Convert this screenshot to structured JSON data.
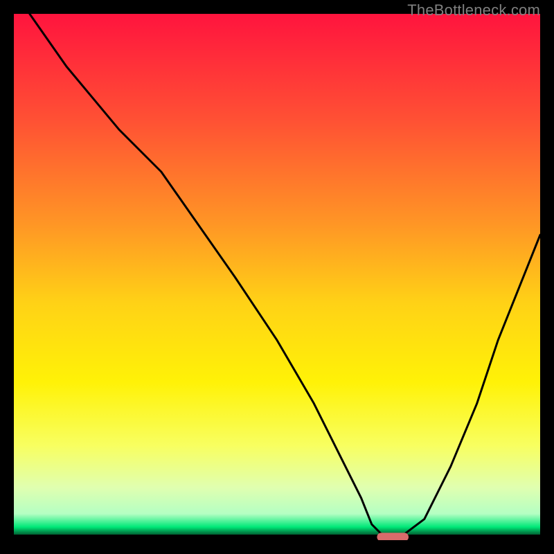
{
  "watermark": {
    "text": "TheBottleneck.com"
  },
  "chart_data": {
    "type": "line",
    "title": "",
    "xlabel": "",
    "ylabel": "",
    "xlim": [
      0,
      100
    ],
    "ylim": [
      0,
      100
    ],
    "grid": false,
    "legend": false,
    "background_gradient": {
      "stops": [
        {
          "pos": 0.0,
          "color": "#ff143e"
        },
        {
          "pos": 0.2,
          "color": "#ff5034"
        },
        {
          "pos": 0.4,
          "color": "#ff9625"
        },
        {
          "pos": 0.55,
          "color": "#ffd216"
        },
        {
          "pos": 0.7,
          "color": "#fff207"
        },
        {
          "pos": 0.82,
          "color": "#f8ff60"
        },
        {
          "pos": 0.9,
          "color": "#e0ffb0"
        },
        {
          "pos": 0.95,
          "color": "#b4ffc3"
        },
        {
          "pos": 0.975,
          "color": "#00e878"
        },
        {
          "pos": 1.0,
          "color": "#000000"
        }
      ]
    },
    "series": [
      {
        "name": "bottleneck-curve",
        "color": "#000000",
        "x": [
          3,
          10,
          20,
          28,
          35,
          42,
          50,
          57,
          62,
          66,
          68,
          70,
          74,
          78,
          83,
          88,
          92,
          96,
          100
        ],
        "y": [
          100,
          90,
          78,
          70,
          60,
          50,
          38,
          26,
          16,
          8,
          3,
          1,
          1,
          4,
          14,
          26,
          38,
          48,
          58
        ]
      }
    ],
    "marker": {
      "name": "optimal-range",
      "shape": "capsule",
      "color": "#d86b6b",
      "x_center": 72,
      "y": 0.6,
      "width": 6,
      "height": 1.6
    }
  }
}
